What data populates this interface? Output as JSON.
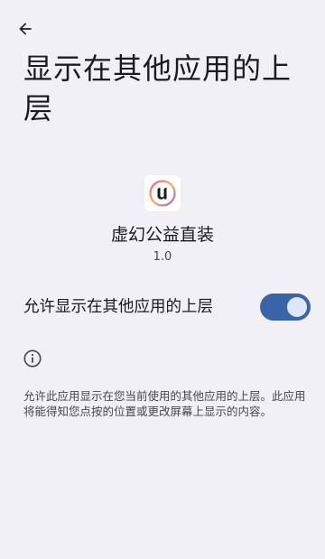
{
  "header": {
    "back_icon": "arrow-left-icon",
    "title": "显示在其他应用的上层"
  },
  "app": {
    "icon": "unreal-engine-logo",
    "name": "虚幻公益直装",
    "version": "1.0"
  },
  "permission": {
    "label": "允许显示在其他应用的上层",
    "enabled": true,
    "accent_color": "#3a64a8"
  },
  "info": {
    "icon": "info-circle-icon",
    "text": "允许此应用显示在您当前使用的其他应用的上层。此应用将能得知您点按的位置或更改屏幕上显示的内容。"
  }
}
